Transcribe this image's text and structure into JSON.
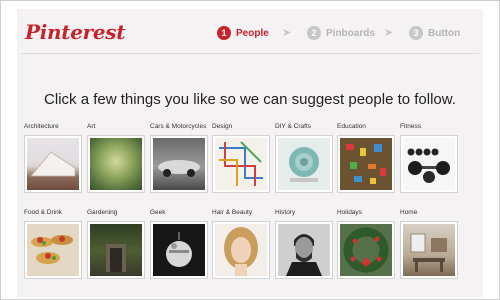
{
  "brand": {
    "logo": "Pinterest",
    "color": "#c8232c"
  },
  "steps": [
    {
      "number": "1",
      "label": "People",
      "state": "active"
    },
    {
      "number": "2",
      "label": "Pinboards",
      "state": "inactive"
    },
    {
      "number": "3",
      "label": "Button",
      "state": "inactive"
    }
  ],
  "step_arrow": "➤",
  "headline": "Click a few things you like so we can suggest people to follow.",
  "categories": [
    {
      "label": "Architecture",
      "row": 1
    },
    {
      "label": "Art",
      "row": 1
    },
    {
      "label": "Cars & Motorcycles",
      "row": 1
    },
    {
      "label": "Design",
      "row": 1
    },
    {
      "label": "DIY & Crafts",
      "row": 1
    },
    {
      "label": "Education",
      "row": 1
    },
    {
      "label": "Fitness",
      "row": 1
    },
    {
      "label": "Food & Drink",
      "row": 2
    },
    {
      "label": "Gardening",
      "row": 2
    },
    {
      "label": "Geek",
      "row": 2
    },
    {
      "label": "Hair & Beauty",
      "row": 2
    },
    {
      "label": "History",
      "row": 2
    },
    {
      "label": "Holidays",
      "row": 2
    },
    {
      "label": "Home",
      "row": 2
    }
  ]
}
